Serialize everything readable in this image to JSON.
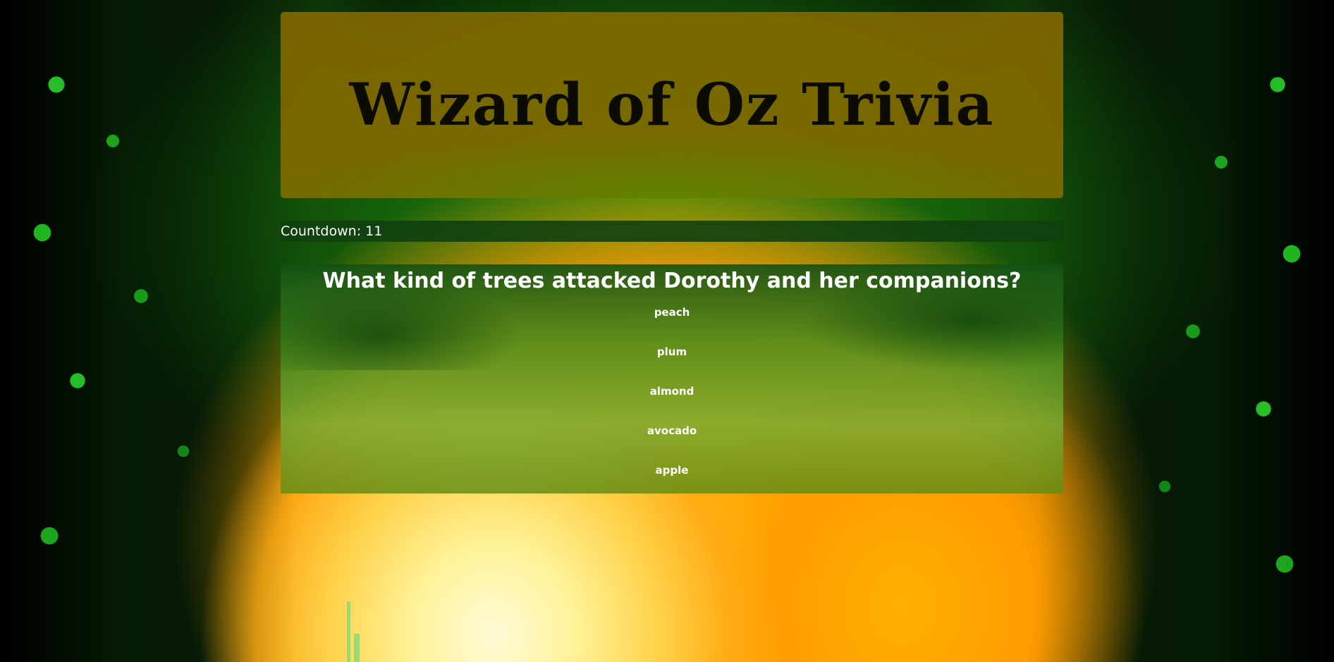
{
  "header": {
    "title": "Wizard of Oz Trivia"
  },
  "countdown": {
    "text": "Countdown: 11"
  },
  "quiz": {
    "question": "What kind of trees attacked Dorothy and her companions?",
    "answers": [
      "peach",
      "plum",
      "almond",
      "avocado",
      "apple"
    ]
  },
  "colors": {
    "header_bg": "#806800",
    "title_text": "#0b0b00",
    "panel_green": "#104010",
    "text_white": "#ffffff"
  }
}
